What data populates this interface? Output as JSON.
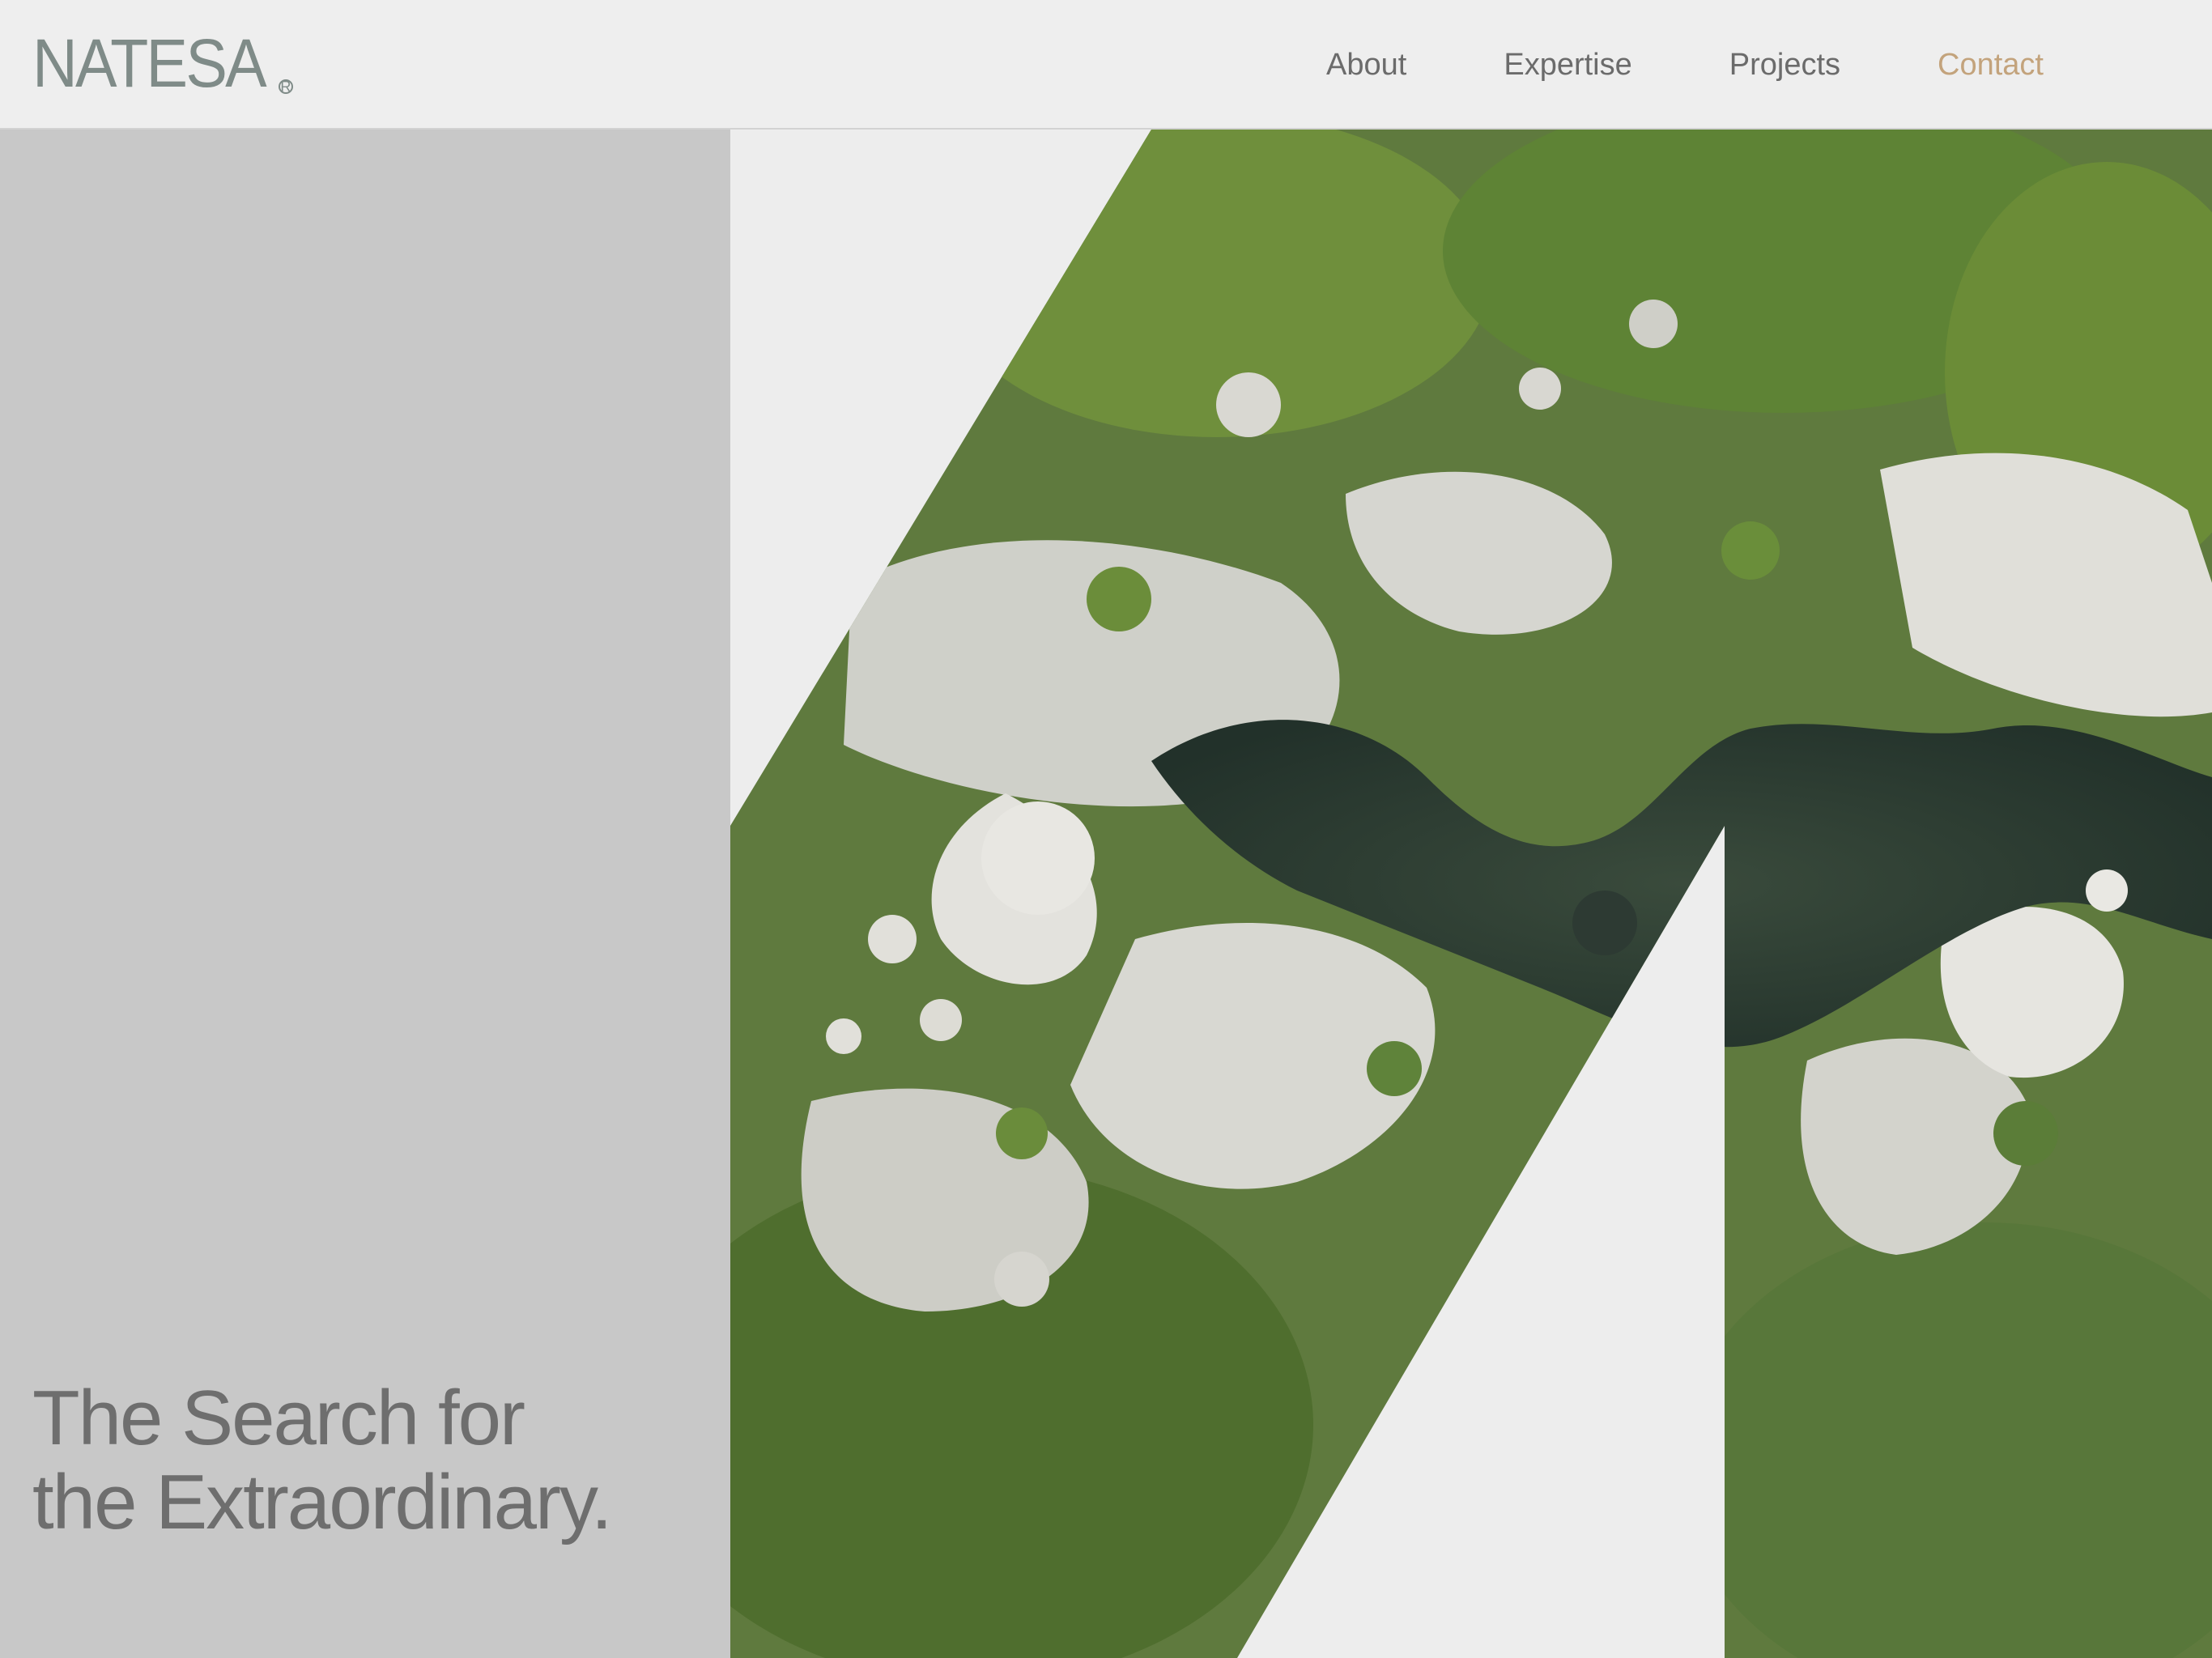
{
  "brand": {
    "name": "NATESA",
    "mark": "R"
  },
  "nav": {
    "items": [
      {
        "label": "About"
      },
      {
        "label": "Expertise"
      },
      {
        "label": "Projects"
      },
      {
        "label": "Contact"
      }
    ]
  },
  "hero": {
    "headline_line1": "The Search for",
    "headline_line2": "the Extraordinary.",
    "image_subject": "aerial-river-canyon-photo"
  },
  "colors": {
    "background": "#ededed",
    "header_bg": "#eeeeee",
    "left_panel": "#c8c8c8",
    "logo": "#7f8b88",
    "nav_text": "#6b6b6b",
    "accent": "#c3a37c",
    "headline": "#6e6e6e"
  }
}
